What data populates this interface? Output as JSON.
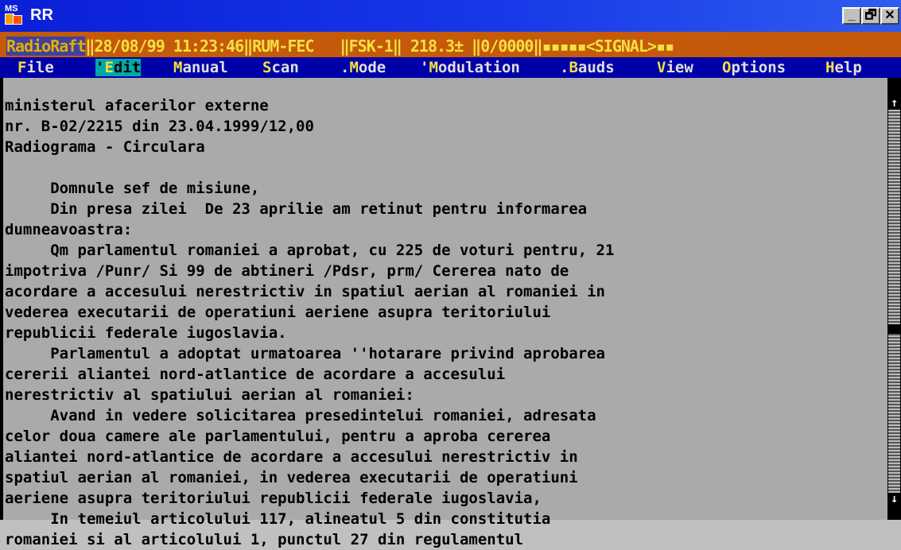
{
  "window": {
    "title": "RR",
    "icon_label": "MS"
  },
  "window_buttons": {
    "minimize": "_",
    "maximize": "🗗",
    "close": "✕"
  },
  "status_line": {
    "brand": "RadioRaft",
    "rest": "‖28/08/99 11:23:46‖RUM-FEC   ‖FSK-1‖ 218.3± ‖0/0000‖▪▪▪▪▪<SIGNAL>▪▪"
  },
  "menu": [
    {
      "label": "File",
      "hot": "F",
      "rest": "ile"
    },
    {
      "label": "Edit",
      "hot": "E",
      "rest": "dit",
      "prefix": "'"
    },
    {
      "label": "Manual",
      "hot": "M",
      "rest": "anual"
    },
    {
      "label": "Scan",
      "hot": "S",
      "rest": "can"
    },
    {
      "label": ".Mode",
      "hot": "M",
      "rest": "ode",
      "prefix": "."
    },
    {
      "label": "'Modulation",
      "hot": "M",
      "rest": "odulation",
      "prefix": "'"
    },
    {
      "label": ".Bauds",
      "hot": "B",
      "rest": "auds",
      "prefix": "."
    },
    {
      "label": "View",
      "hot": "V",
      "rest": "iew"
    },
    {
      "label": "Options",
      "hot": "O",
      "rest": "ptions"
    },
    {
      "label": "Help",
      "hot": "H",
      "rest": "elp"
    }
  ],
  "document_lines": [
    "ministerul afacerilor externe",
    "nr. B-02/2215 din 23.04.1999/12,00",
    "Radiograma - Circulara",
    "",
    "     Domnule sef de misiune,",
    "     Din presa zilei  De 23 aprilie am retinut pentru informarea",
    "dumneavoastra:",
    "     Qm parlamentul romaniei a aprobat, cu 225 de voturi pentru, 21",
    "impotriva /Punr/ Si 99 de abtineri /Pdsr, prm/ Cererea nato de",
    "acordare a accesului nerestrictiv in spatiul aerian al romaniei in",
    "vederea executarii de operatiuni aeriene asupra teritoriului",
    "republicii federale iugoslavia.",
    "     Parlamentul a adoptat urmatoarea ''hotarare privind aprobarea",
    "cererii aliantei nord-atlantice de acordare a accesului",
    "nerestrictiv al spatiului aerian al romaniei:",
    "     Avand in vedere solicitarea presedintelui romaniei, adresata",
    "celor doua camere ale parlamentului, pentru a aproba cererea",
    "aliantei nord-atlantice de acordare a accesului nerestrictiv in",
    "spatiul aerian al romaniei, in vederea executarii de operatiuni",
    "aeriene asupra teritoriului republicii federale iugoslavia,",
    "     In temeiul articolului 117, alineatul 5 din constitutia",
    "romaniei si al articolului 1, punctul 27 din regulamentul"
  ],
  "scrollbar": {
    "up": "↑",
    "down": "↓"
  },
  "colors": {
    "title_bar": "#0a1fd6",
    "status_bar": "#c45a0a",
    "menu_bar": "#0000a8",
    "menu_highlight": "#00a8a8",
    "text_bg": "#aaaaaa"
  }
}
